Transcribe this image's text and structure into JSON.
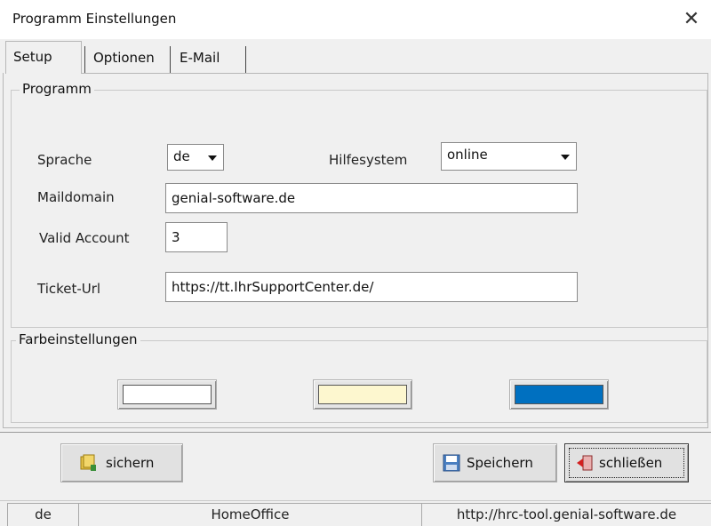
{
  "window": {
    "title": "Programm Einstellungen"
  },
  "tabs": [
    {
      "label": "Setup",
      "active": true
    },
    {
      "label": "Optionen",
      "active": false
    },
    {
      "label": "E-Mail",
      "active": false
    }
  ],
  "programm": {
    "legend": "Programm",
    "sprache": {
      "label": "Sprache",
      "value": "de"
    },
    "hilfesystem": {
      "label": "Hilfesystem",
      "value": "online"
    },
    "maildomain": {
      "label": "Maildomain",
      "value": "genial-software.de"
    },
    "valid_account": {
      "label": "Valid Account",
      "value": "3"
    },
    "ticket_url": {
      "label": "Ticket-Url",
      "value": "https://tt.IhrSupportCenter.de/"
    }
  },
  "farben": {
    "legend": "Farbeinstellungen",
    "swatches": [
      {
        "name": "white",
        "color": "#ffffff"
      },
      {
        "name": "cream",
        "color": "#fdf7cf"
      },
      {
        "name": "blue",
        "color": "#0070c0"
      }
    ]
  },
  "buttons": {
    "sichern": "sichern",
    "speichern": "Speichern",
    "schliessen": "schließen"
  },
  "statusbar": {
    "language": "de",
    "location": "HomeOffice",
    "url": "http://hrc-tool.genial-software.de"
  }
}
